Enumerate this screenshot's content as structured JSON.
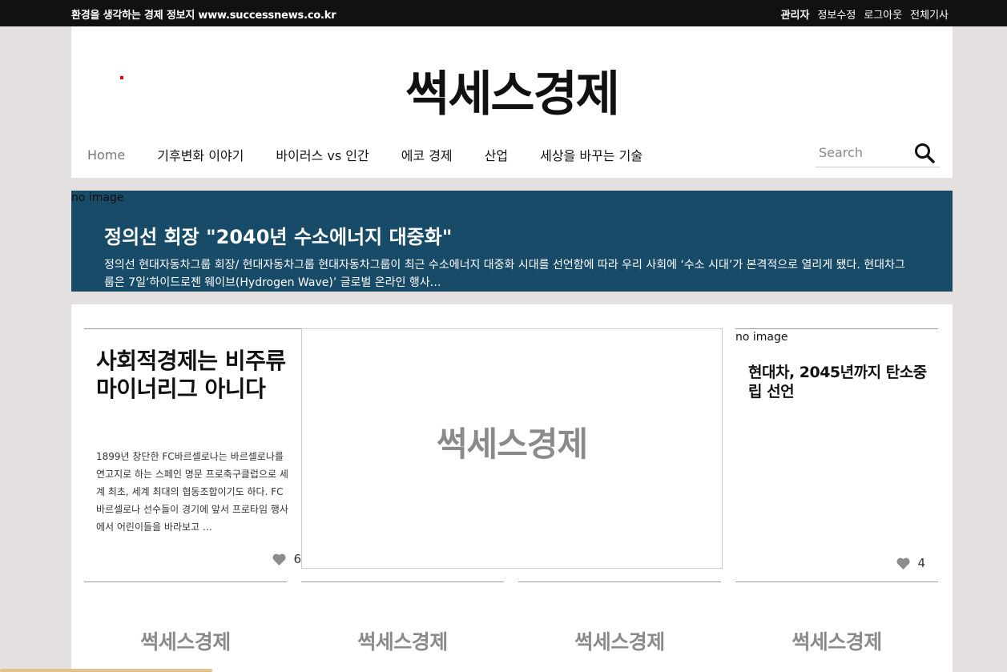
{
  "topbar": {
    "tagline": "환경을 생각하는 경제 정보지 www.successnews.co.kr",
    "links": [
      "관리자",
      "정보수정",
      "로그아웃",
      "전체기사"
    ]
  },
  "header": {
    "logo": "썩세스경제",
    "nav": [
      "Home",
      "기후변화 이야기",
      "바이러스 vs 인간",
      "에코 경제",
      "산업",
      "세상을 바꾸는 기술"
    ],
    "search_placeholder": "Search"
  },
  "banner": {
    "noimage": "no image",
    "title": "정의선 회장 \"2040년 수소에너지 대중화\"",
    "summary": "정의선 현대자동차그룹 회장/ 현대자동차그룹 현대자동차그룹이 최근 수소에너지 대중화 시대를 선언함에 따라 우리 사회에 ‘수소 시대’가 본격적으로 열리게 됐다. 현대차그룹은 7일‘하이드로젠 웨이브(Hydrogen Wave)’ 글로벌 온라인 행사…"
  },
  "articles": {
    "left": {
      "title": "사회적경제는 비주류 마이너리그 아니다",
      "body": "1899년 창단한 FC바르셀로나는 바르셀로나를 연고지로 하는 스페인 명문 프로축구클럽으로 세계 최초, 세계 최대의 협동조합이기도 하다. FC바르셀로나 선수들이 경기에 앞서 프로타임 행사에서 어린이들을 바라보고 …",
      "likes": "6"
    },
    "center": {
      "placeholder": "썩세스경제"
    },
    "right": {
      "noimage": "no image",
      "title": "현대차, 2045년까지 탄소중립 선언",
      "likes": "4"
    },
    "bottom": [
      "썩세스경제",
      "썩세스경제",
      "썩세스경제",
      "썩세스경제"
    ]
  },
  "colors": {
    "banner_bg": "#174b68",
    "topbar_bg": "#111111",
    "page_bg": "#e4e0df",
    "placeholder_text": "#8a8a8a"
  }
}
